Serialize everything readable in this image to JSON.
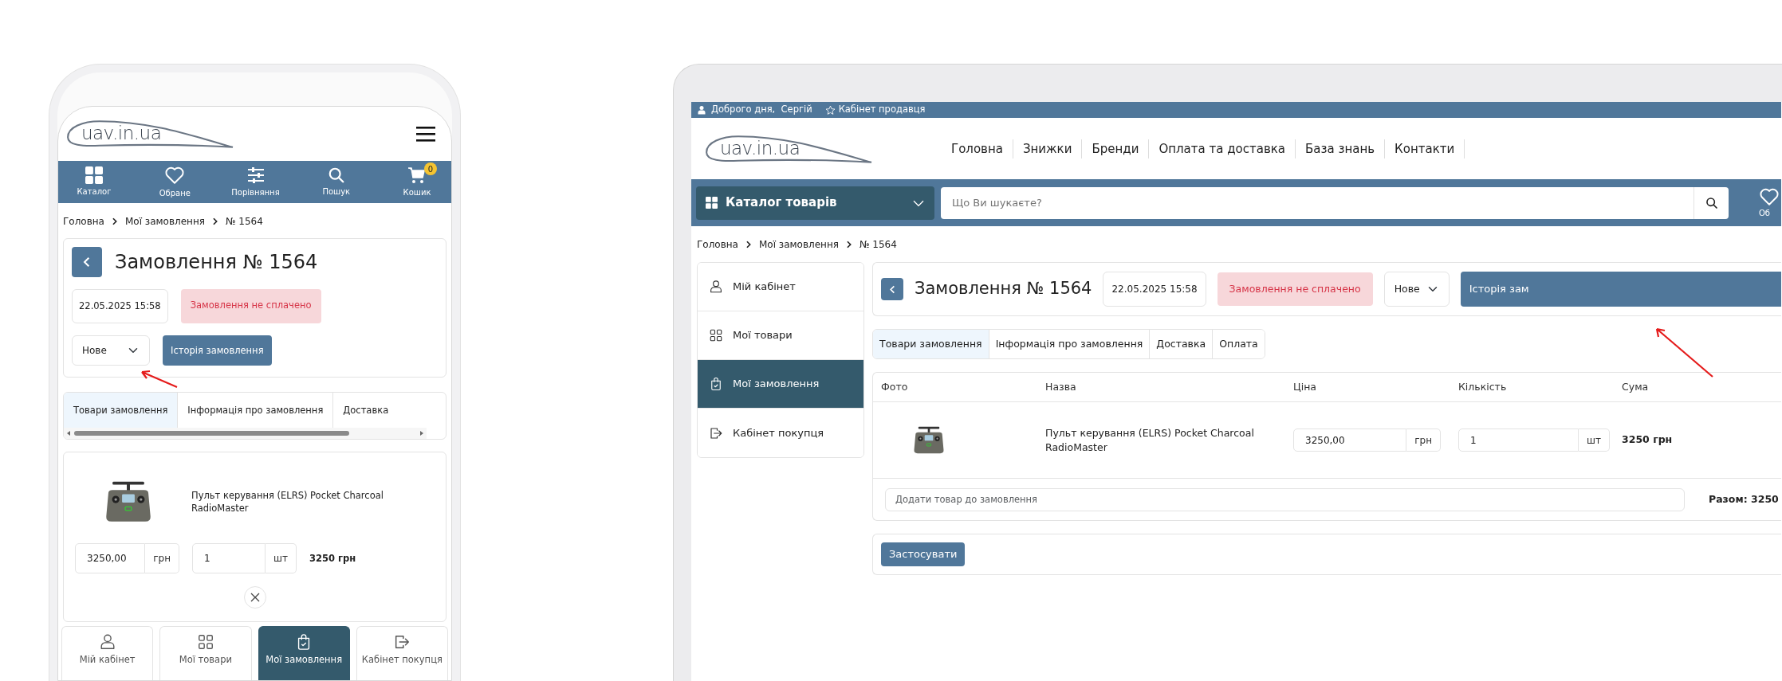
{
  "phone": {
    "logo": "uav.in.ua",
    "nav": [
      {
        "label": "Каталог"
      },
      {
        "label": "Обране"
      },
      {
        "label": "Порівняння"
      },
      {
        "label": "Пошук"
      },
      {
        "label": "Кошик"
      }
    ],
    "cart_count": "0",
    "breadcrumb": [
      "Головна",
      "Мої замовлення",
      "№ 1564"
    ],
    "order": {
      "title": "Замовлення № 1564",
      "date": "22.05.2025 15:58",
      "payment_status": "Замовлення не сплачено",
      "status": "Нове",
      "history_button": "Історія замовлення"
    },
    "tabs": [
      {
        "label": "Товари замовлення",
        "selected": true
      },
      {
        "label": "Інформація про замовлення",
        "selected": false
      },
      {
        "label": "Доставка",
        "selected": false
      }
    ],
    "product": {
      "name": "Пульт керування (ELRS) Pocket Charcoal RadioMaster",
      "price": "3250,00",
      "currency": "грн",
      "quantity": "1",
      "unit": "шт",
      "sum": "3250 грн"
    },
    "account_nav": [
      {
        "label": "Мій кабінет",
        "selected": false
      },
      {
        "label": "Мої товари",
        "selected": false
      },
      {
        "label": "Мої замовлення",
        "selected": true
      },
      {
        "label": "Кабінет покупця",
        "selected": false
      }
    ]
  },
  "laptop": {
    "greeting": "Доброго дня,  Сергій",
    "seller_cabinet": "Кабінет продавця",
    "logo": "uav.in.ua",
    "menu": [
      "Головна",
      "Знижки",
      "Бренди",
      "Оплата та доставка",
      "База знань",
      "Контакти"
    ],
    "catalog_button": "Каталог товарів",
    "search": {
      "placeholder": "Що Ви шукаєте?"
    },
    "wishlist_label": "Об",
    "breadcrumb": [
      "Головна",
      "Мої замовлення",
      "№ 1564"
    ],
    "sidebar": [
      {
        "label": "Мій кабінет",
        "selected": false
      },
      {
        "label": "Мої товари",
        "selected": false
      },
      {
        "label": "Мої замовлення",
        "selected": true
      },
      {
        "label": "Кабінет покупця",
        "selected": false
      }
    ],
    "order": {
      "title": "Замовлення № 1564",
      "date": "22.05.2025 15:58",
      "payment_status": "Замовлення не сплачено",
      "status": "Нове",
      "history_button": "Історія зам"
    },
    "tabs": [
      {
        "label": "Товари замовлення",
        "selected": true
      },
      {
        "label": "Інформація про замовлення",
        "selected": false
      },
      {
        "label": "Доставка",
        "selected": false
      },
      {
        "label": "Оплата",
        "selected": false
      }
    ],
    "table": {
      "columns": [
        "Фото",
        "Назва",
        "Ціна",
        "Кількість",
        "Сума"
      ],
      "rows": [
        {
          "name": "Пульт керування (ELRS) Pocket Charcoal RadioMaster",
          "price": "3250,00",
          "currency": "грн",
          "quantity": "1",
          "unit": "шт",
          "sum": "3250 грн"
        }
      ]
    },
    "add_item": {
      "placeholder": "Додати товар до замовлення"
    },
    "total": "Разом: 3250",
    "apply_button": "Застосувати"
  }
}
